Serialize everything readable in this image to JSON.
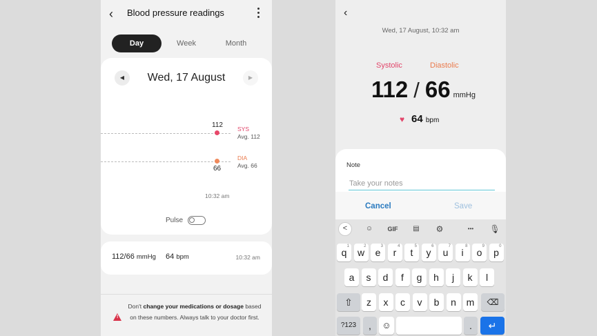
{
  "left": {
    "header": {
      "title": "Blood pressure readings"
    },
    "tabs": [
      "Day",
      "Week",
      "Month"
    ],
    "active_tab": "Day",
    "date": "Wed, 17 August",
    "chart": {
      "sys_value": "112",
      "dia_value": "66",
      "sys_label": "SYS",
      "sys_avg": "Avg. 112",
      "dia_label": "DIA",
      "dia_avg": "Avg. 66",
      "time": "10:32 am",
      "sys_color": "#e8486a",
      "dia_color": "#f08a5c"
    },
    "pulse_label": "Pulse",
    "reading": {
      "bp": "112/66",
      "bp_unit": "mmHg",
      "pulse": "64",
      "pulse_unit": "bpm",
      "time": "10:32 am"
    },
    "warning": {
      "pre": "Don't ",
      "bold": "change your medications or dosage",
      "post": " based on these numbers. Always talk to your doctor first."
    }
  },
  "right": {
    "timestamp": "Wed, 17 August, 10:32 am",
    "systolic_label": "Systolic",
    "diastolic_label": "Diastolic",
    "systolic": "112",
    "slash": "/",
    "diastolic": "66",
    "unit": "mmHg",
    "pulse": "64",
    "pulse_unit": "bpm",
    "note_label": "Note",
    "note_placeholder": "Take your notes",
    "cancel": "Cancel",
    "save": "Save",
    "keyboard": {
      "toolbar": {
        "back": "<",
        "gif": "GIF",
        "more": "•••"
      },
      "row1": [
        "q",
        "w",
        "e",
        "r",
        "t",
        "y",
        "u",
        "i",
        "o",
        "p"
      ],
      "row1_numbers": [
        "1",
        "2",
        "3",
        "4",
        "5",
        "6",
        "7",
        "8",
        "9",
        "0"
      ],
      "row2": [
        "a",
        "s",
        "d",
        "f",
        "g",
        "h",
        "j",
        "k",
        "l"
      ],
      "row3": [
        "z",
        "x",
        "c",
        "v",
        "b",
        "n",
        "m"
      ],
      "symbols_key": "?123",
      "comma": ",",
      "period": "."
    }
  }
}
